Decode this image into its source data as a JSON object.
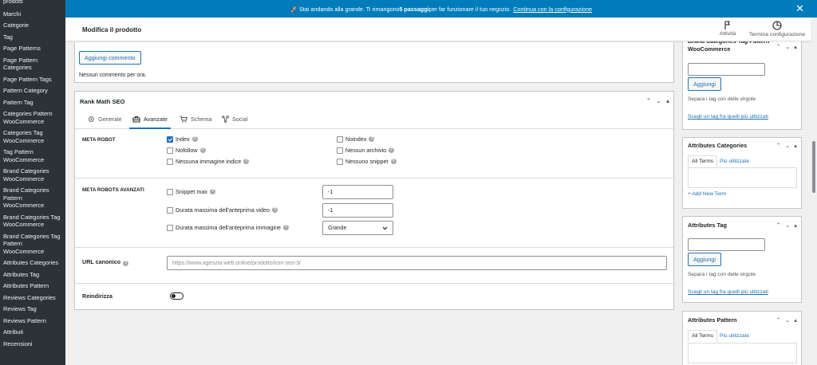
{
  "sidebar": {
    "items": [
      {
        "label": "prodotti"
      },
      {
        "label": "Marchi"
      },
      {
        "label": "Categorie"
      },
      {
        "label": "Tag"
      },
      {
        "label": "Page Patterns"
      },
      {
        "label": "Page Pattern Categories"
      },
      {
        "label": "Page Pattern Tags"
      },
      {
        "label": "Pattern Category"
      },
      {
        "label": "Pattern Tag"
      },
      {
        "label": "Categories Pattern WooCommerce"
      },
      {
        "label": "Categories Tag WooCommerce"
      },
      {
        "label": "Tag Pattern WooCommerce"
      },
      {
        "label": "Brand Categories WooCommerce"
      },
      {
        "label": "Brand Categories Pattern WooCommerce"
      },
      {
        "label": "Brand Categories Tag WooCommerce"
      },
      {
        "label": "Brand Categories Tag Pattern WooCommerce"
      },
      {
        "label": "Attributes Categories"
      },
      {
        "label": "Attributes Tag"
      },
      {
        "label": "Attributes Pattern"
      },
      {
        "label": "Reviews Categories"
      },
      {
        "label": "Reviews Tag"
      },
      {
        "label": "Reviews Pattern"
      },
      {
        "label": "Attributi"
      },
      {
        "label": "Recensioni"
      }
    ]
  },
  "notice": {
    "emoji": "🚀",
    "text_pre": "Stai andando alla grande. Ti rimangono ",
    "text_bold": "5 passaggi",
    "text_post": " per far funzionare il tuo negozio.",
    "link": "Continua con la configurazione",
    "close": "✕"
  },
  "header": {
    "title": "Modifica il prodotto",
    "activity_label": "Attività",
    "finish_label": "Termina configurazione"
  },
  "comments": {
    "add_button": "Aggiungi commento",
    "empty_text": "Nessun commento per ora."
  },
  "rankmath": {
    "title": "Rank Math SEO",
    "tabs": [
      {
        "label": "Generale",
        "icon": "gear-icon"
      },
      {
        "label": "Avanzate",
        "icon": "toolbox-icon"
      },
      {
        "label": "Schema",
        "icon": "cart-icon"
      },
      {
        "label": "Social",
        "icon": "share-icon"
      }
    ],
    "meta_robot_label": "META ROBOT",
    "robots_left": [
      {
        "label": "Index",
        "checked": true
      },
      {
        "label": "Nofollow",
        "checked": false
      },
      {
        "label": "Nessuna immagine indice",
        "checked": false
      }
    ],
    "robots_right": [
      {
        "label": "Noindex",
        "checked": false
      },
      {
        "label": "Nessun archivio",
        "checked": false
      },
      {
        "label": "Nessuno snippet",
        "checked": false
      }
    ],
    "advanced_label": "META ROBOTS AVANZATI",
    "advanced": [
      {
        "label": "Snippet max",
        "value": "-1"
      },
      {
        "label": "Durata massima dell'anteprima video",
        "value": "-1"
      },
      {
        "label": "Durata massima dell'anteprima immagine",
        "value": "Grande"
      }
    ],
    "canonical_label": "URL canonico",
    "canonical_placeholder": "https://www.agenzia-web.online/prodotto/iron-seo-3/",
    "redirect_label": "Reindirizza"
  },
  "side": {
    "brand_tag_pattern": {
      "title": "Brand Categories Tag Pattern WooCommerce",
      "add_button": "Aggiungi",
      "hint": "Separa i tag con delle virgole",
      "link": "Scegli un tag fra quelli più utilizzati"
    },
    "attr_categories": {
      "title": "Attributes Categories",
      "tab_all": "All Terms",
      "tab_most": "Più utilizzate",
      "add_new": "+ Add New Term"
    },
    "attr_tag": {
      "title": "Attributes Tag",
      "add_button": "Aggiungi",
      "hint": "Separa i tag con delle virgole",
      "link": "Scegli un tag fra quelli più utilizzati"
    },
    "attr_pattern": {
      "title": "Attributes Pattern",
      "tab_all": "All Terms",
      "tab_most": "Più utilizzate"
    }
  },
  "controls": {
    "up": "⌃",
    "down": "⌄",
    "toggle": "▴"
  },
  "colors": {
    "accent": "#2271b1",
    "notice_bg": "#007cba",
    "sidebar_bg": "#2c3338"
  }
}
